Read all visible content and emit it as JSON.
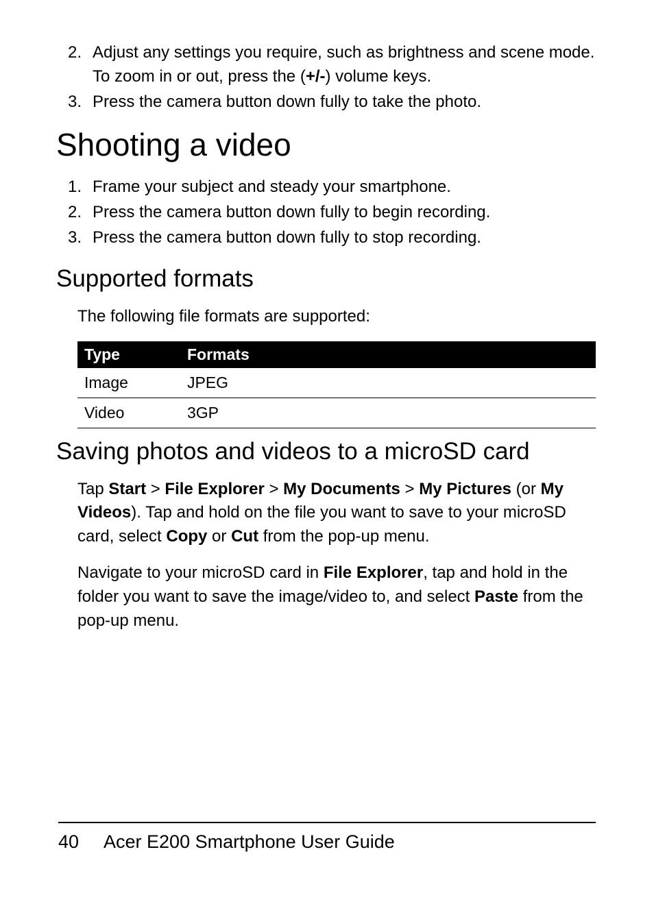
{
  "intro_steps": [
    {
      "n": "2.",
      "text_a": "Adjust any settings you require, such as brightness and scene mode. To zoom in or out, press the (",
      "bold": "+/-",
      "text_b": ") volume keys."
    },
    {
      "n": "3.",
      "text_a": "Press the camera button down fully to take the photo.",
      "bold": "",
      "text_b": ""
    }
  ],
  "heading_video": "Shooting a video",
  "video_steps": [
    {
      "n": "1.",
      "text": "Frame your subject and steady your smartphone."
    },
    {
      "n": "2.",
      "text": "Press the camera button down fully to begin recording."
    },
    {
      "n": "3.",
      "text": "Press the camera button down fully to stop recording."
    }
  ],
  "heading_formats": "Supported formats",
  "formats_intro": "The following file formats are supported:",
  "table": {
    "headers": [
      "Type",
      "Formats"
    ],
    "rows": [
      [
        "Image",
        "JPEG"
      ],
      [
        "Video",
        "3GP"
      ]
    ]
  },
  "heading_save": "Saving photos and videos to a microSD card",
  "save_p1": {
    "parts": [
      {
        "t": "Tap "
      },
      {
        "b": "Start"
      },
      {
        "t": " > "
      },
      {
        "b": "File Explorer"
      },
      {
        "t": " > "
      },
      {
        "b": "My Documents"
      },
      {
        "t": " > "
      },
      {
        "b": "My Pictures"
      },
      {
        "t": " (or "
      },
      {
        "b": "My Videos"
      },
      {
        "t": "). Tap and hold on the file you want to save to your microSD card, select "
      },
      {
        "b": "Copy"
      },
      {
        "t": " or "
      },
      {
        "b": "Cut"
      },
      {
        "t": " from the pop-up menu."
      }
    ]
  },
  "save_p2": {
    "parts": [
      {
        "t": "Navigate to your microSD card in "
      },
      {
        "b": "File Explorer"
      },
      {
        "t": ", tap and hold in the folder you want to save the image/video to, and select "
      },
      {
        "b": "Paste"
      },
      {
        "t": " from the pop-up menu."
      }
    ]
  },
  "footer": {
    "page": "40",
    "title": "Acer E200 Smartphone User Guide"
  }
}
